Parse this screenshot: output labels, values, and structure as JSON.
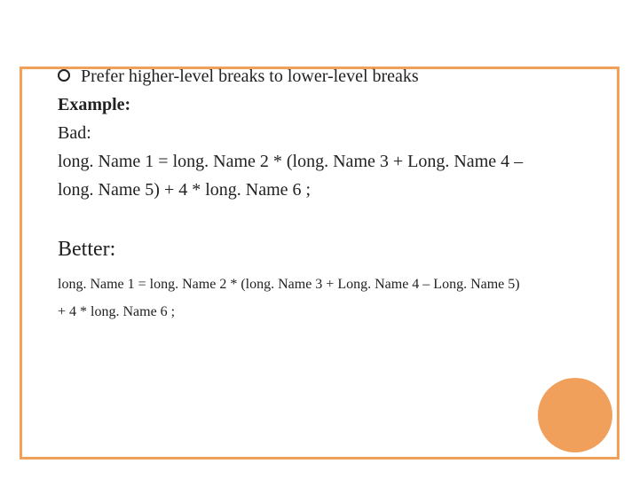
{
  "bullet": "Prefer higher-level breaks to lower-level breaks",
  "example_label": "Example:",
  "bad_label": "Bad:",
  "bad_code_line1": "long. Name 1 = long. Name 2 * (long. Name 3 + Long. Name 4 –",
  "bad_code_line2": "long. Name 5) + 4 * long. Name 6 ;",
  "better_label": "Better:",
  "better_code_line1": "long. Name 1 = long. Name 2 * (long. Name 3 + Long. Name 4 – Long. Name 5)",
  "better_code_line2": "+ 4 * long. Name 6 ;"
}
